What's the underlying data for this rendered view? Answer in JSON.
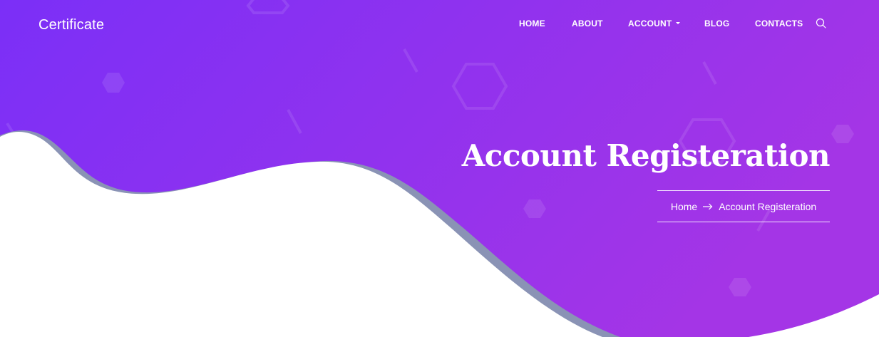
{
  "header": {
    "brand": "Certificate",
    "nav": {
      "home": "HOME",
      "about": "ABOUT",
      "account": "ACCOUNT",
      "blog": "BLOG",
      "contacts": "CONTACTS"
    },
    "search_icon": "search-icon"
  },
  "hero": {
    "title": "Account Registeration",
    "breadcrumb": {
      "home": "Home",
      "separator_icon": "arrow-right-icon",
      "current": "Account Registeration"
    }
  },
  "colors": {
    "gradient_start": "#7b2ff7",
    "gradient_end": "#a435e6",
    "wave_shadow": "#8a93b5",
    "text": "#ffffff",
    "background": "#ffffff"
  }
}
